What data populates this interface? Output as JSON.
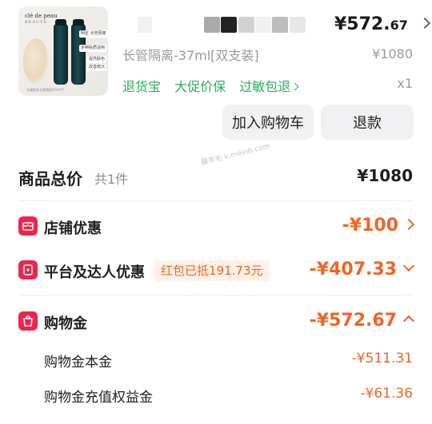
{
  "product": {
    "brand": "clé de peau",
    "brand_sub": "BEAUTÉ",
    "thumb_tag1": "明星 长管隔离",
    "thumb_tag2": "多种肤质适用",
    "thumb_tag3": "提亮肤色",
    "thumb_tag4": "改善暗沉",
    "thumb_caption": "光凝焕采长管隔离37ml*2",
    "price_int": "¥572.",
    "price_dec": "67",
    "spec": "长管隔离-37ml[双支装]",
    "original_price": "¥1080",
    "tags": [
      "退货宝",
      "大促价保",
      "过敏包退"
    ],
    "quantity": "x1"
  },
  "actions": {
    "add_to_cart": "加入购物车",
    "refund": "退款"
  },
  "watermark": "薅羊毛 k.meinb.com",
  "summary": {
    "total_label": "商品总价",
    "total_count": "共1件",
    "total_value": "¥1080"
  },
  "discounts": {
    "shop_label": "店铺优惠",
    "shop_amount": "-¥100",
    "platform_label": "平台及达人优惠",
    "platform_badge": "红包已抵191.73元",
    "platform_amount": "-¥407.33",
    "gold_label": "购物金",
    "gold_amount": "-¥572.67",
    "gold_principal_label": "购物金本金",
    "gold_principal_amount": "-¥511.31",
    "gold_bonus_label": "购物金充值权益金",
    "gold_bonus_amount": "-¥61.36"
  },
  "colors": {
    "accent_orange": "#f06524",
    "icon_red": "#f0234a",
    "tag_green": "#2bad5c"
  }
}
